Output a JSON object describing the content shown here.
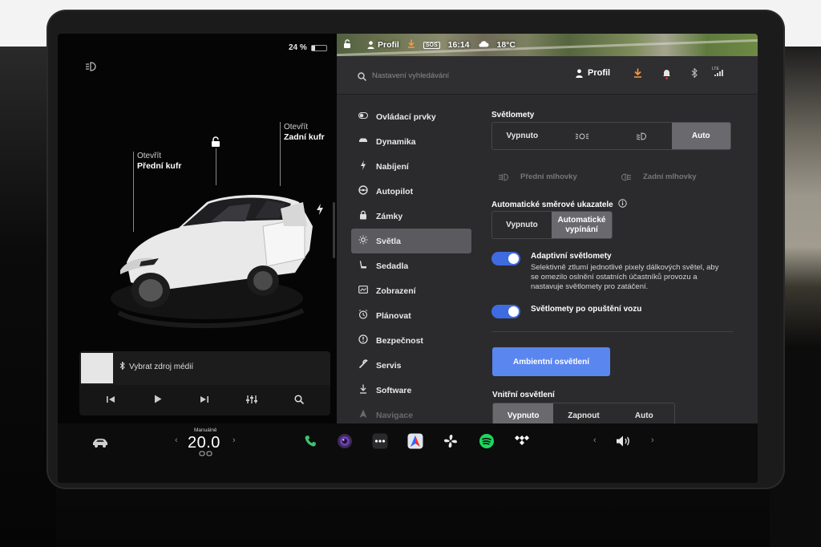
{
  "status": {
    "battery_percent": "24 %",
    "battery_level": 0.24,
    "profile": "Profil",
    "time": "16:14",
    "temperature": "18°C",
    "sos": "SOS"
  },
  "car": {
    "front_trunk": {
      "action": "Otevřít",
      "name": "Přední kufr"
    },
    "rear_trunk": {
      "action": "Otevřít",
      "name": "Zadní kufr"
    }
  },
  "media": {
    "source_label": "Vybrat zdroj médií"
  },
  "settings": {
    "search_placeholder": "Nastavení vyhledávání",
    "profile_label": "Profil",
    "nav": [
      {
        "label": "Ovládací prvky",
        "icon": "toggle-icon"
      },
      {
        "label": "Dynamika",
        "icon": "car-icon"
      },
      {
        "label": "Nabíjení",
        "icon": "bolt-icon"
      },
      {
        "label": "Autopilot",
        "icon": "steering-wheel-icon"
      },
      {
        "label": "Zámky",
        "icon": "lock-icon"
      },
      {
        "label": "Světla",
        "icon": "sun-icon",
        "active": true
      },
      {
        "label": "Sedadla",
        "icon": "seat-icon"
      },
      {
        "label": "Zobrazení",
        "icon": "display-icon"
      },
      {
        "label": "Plánovat",
        "icon": "clock-icon"
      },
      {
        "label": "Bezpečnost",
        "icon": "shield-icon"
      },
      {
        "label": "Servis",
        "icon": "wrench-icon"
      },
      {
        "label": "Software",
        "icon": "download-icon"
      },
      {
        "label": "Navigace",
        "icon": "navigation-icon"
      }
    ],
    "headlights": {
      "title": "Světlomety",
      "options": [
        "Vypnuto",
        "",
        "",
        "Auto"
      ],
      "selected": "Auto"
    },
    "fog": {
      "front": "Přední mlhovky",
      "rear": "Zadní mlhovky"
    },
    "turn_signals": {
      "title": "Automatické směrové ukazatele",
      "options": [
        "Vypnuto",
        "Automatické vypínání"
      ],
      "selected": "Automatické vypínání"
    },
    "adaptive": {
      "label": "Adaptivní světlomety",
      "description": "Selektivně ztlumí jednotlivé pixely dálkových světel, aby se omezilo oslnění ostatních účastníků provozu a nastavuje světlomety pro zatáčení.",
      "enabled": true
    },
    "after_exit": {
      "label": "Světlomety po opuštění vozu",
      "enabled": true
    },
    "ambient_button": "Ambientní osvětlení",
    "interior": {
      "title": "Vnitřní osvětlení",
      "options": [
        "Vypnuto",
        "Zapnout",
        "Auto"
      ],
      "selected": "Vypnuto"
    }
  },
  "dock": {
    "climate_mode": "Manuálně",
    "temperature": "20.0",
    "apps": [
      "phone-icon",
      "camera-icon",
      "more-icon",
      "navigation-app-icon",
      "fan-icon",
      "spotify-icon",
      "tidal-icon"
    ],
    "volume_icon": "speaker-icon"
  },
  "colors": {
    "accent_blue": "#3e6ce0",
    "button_blue": "#5a86f0",
    "download_orange": "#ff9a3c",
    "phone_green": "#3ec46d",
    "spotify_green": "#1ed760"
  }
}
